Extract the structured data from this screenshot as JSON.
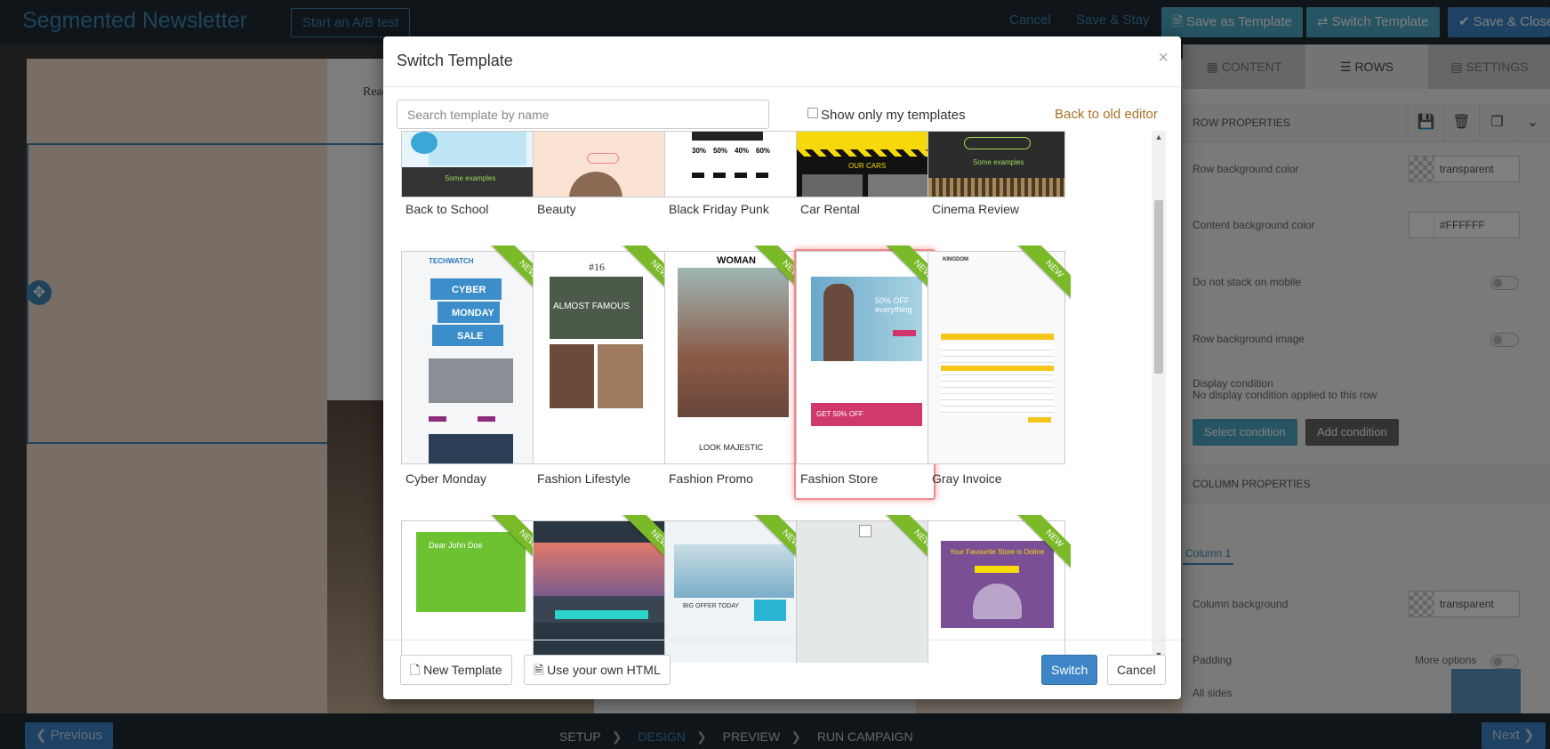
{
  "topbar": {
    "title": "Segmented Newsletter",
    "ab_test": "Start an A/B test",
    "cancel": "Cancel",
    "save_stay": "Save & Stay",
    "save_template": "Save as Template",
    "switch_template": "Switch Template",
    "save_close": "Save & Close"
  },
  "canvas": {
    "read_online": "Read our"
  },
  "panel": {
    "tabs": [
      "CONTENT",
      "ROWS",
      "SETTINGS"
    ],
    "row_properties": "ROW PROPERTIES",
    "row_bg_label": "Row background color",
    "row_bg_value": "transparent",
    "content_bg_label": "Content background color",
    "content_bg_value": "#FFFFFF",
    "no_stack_label": "Do not stack on mobile",
    "row_bg_image_label": "Row background image",
    "display_condition_label": "Display condition",
    "display_condition_note": "No display condition applied to this row",
    "select_condition": "Select condition",
    "add_condition": "Add condition",
    "column_properties": "COLUMN PROPERTIES",
    "column_tab": "Column 1",
    "column_bg_label": "Column background",
    "column_bg_value": "transparent",
    "padding_label": "Padding",
    "more_options": "More options",
    "all_sides": "All sides"
  },
  "bottombar": {
    "previous": "Previous",
    "next": "Next",
    "steps": [
      "SETUP",
      "DESIGN",
      "PREVIEW",
      "RUN CAMPAIGN"
    ],
    "active_step": "DESIGN"
  },
  "modal": {
    "title": "Switch Template",
    "close": "×",
    "search_placeholder": "Search template by name",
    "only_mine": "Show only my templates",
    "back_old_editor": "Back to old editor",
    "new_badge": "NEW",
    "row1": [
      "Back to School",
      "Beauty",
      "Black Friday Punk",
      "Car Rental",
      "Cinema Review"
    ],
    "row2": [
      "Cyber Monday",
      "Fashion Lifestyle",
      "Fashion Promo",
      "Fashion Store",
      "Gray Invoice"
    ],
    "selected": "Fashion Store",
    "thumb_text": {
      "cyber": [
        "CYBER",
        "MONDAY",
        "SALE"
      ],
      "techwatch": "TECHWATCH",
      "lifestyle_num": "#16",
      "lifestyle_head": "ALMOST FAMOUS",
      "woman": "WOMAN",
      "majestic": "LOOK MAJESTIC",
      "store_offer": "50% OFF everything",
      "store_get": "GET 50% OFF",
      "invoice": "KINGDOM",
      "typeqd": "Dear John Doe",
      "bigoffer": "BIG OFFER TODAY",
      "fav_store": "Your Favourite Store is Online",
      "cars": "OUR CARS",
      "some_examples": "Some examples",
      "blackfriday": [
        "30%",
        "50%",
        "40%",
        "60%"
      ]
    },
    "new_template": "New Template",
    "own_html": "Use your own HTML",
    "switch": "Switch",
    "cancel": "Cancel"
  },
  "colors": {
    "accent": "#3d85c6",
    "ribbon": "#7ab928",
    "selected_border": "#f08a8a",
    "link_gold": "#a77124"
  }
}
